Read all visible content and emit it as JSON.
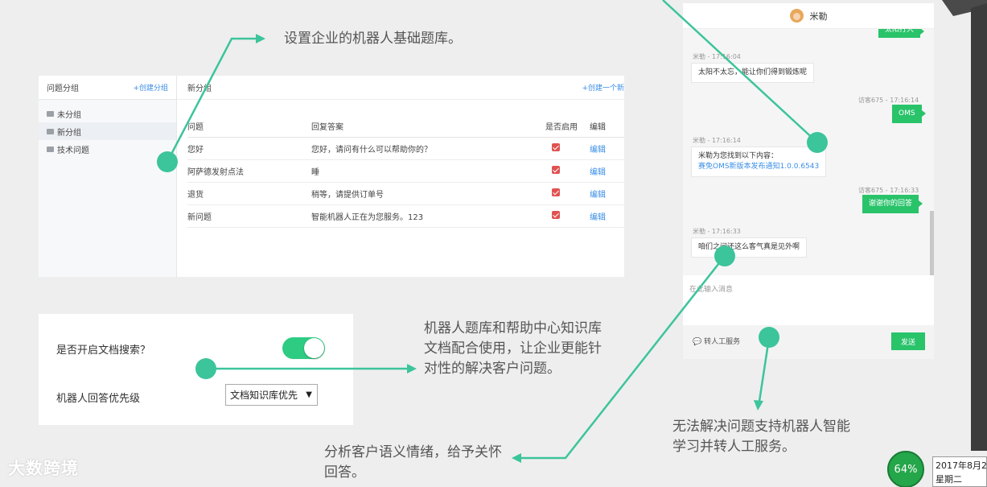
{
  "qlib": {
    "sidebar_title": "问题分组",
    "create_group": "+创建分组",
    "groups": [
      "未分组",
      "新分组",
      "技术问题"
    ],
    "main_title": "新分组",
    "create_question": "+创建一个新",
    "headers": [
      "问题",
      "回复答案",
      "是否启用",
      "编辑"
    ],
    "rows": [
      {
        "q": "您好",
        "a": "您好，请问有什么可以帮助你的？",
        "edit": "编辑"
      },
      {
        "q": "阿萨德发射点法",
        "a": "睡",
        "edit": "编辑"
      },
      {
        "q": "退货",
        "a": "稍等，请提供订单号",
        "edit": "编辑"
      },
      {
        "q": "新问题",
        "a": "智能机器人正在为您服务。123",
        "edit": "编辑"
      }
    ]
  },
  "settings": {
    "doc_search_label": "是否开启文档搜索？",
    "doc_search_enabled": true,
    "priority_label": "机器人回答优先级",
    "priority_value": "文档知识库优先"
  },
  "chat": {
    "agent_name": "米勒",
    "top_cut_bubble": "太阳打大",
    "msg1_meta": "米勒 - 17:16:04",
    "msg1_text": "太阳不太忘，能让你们得到锻炼呢",
    "msg2_meta": "访客675 - 17:16:14",
    "msg2_text": "OMS",
    "msg3_meta": "米勒 - 17:16:14",
    "msg3_line1": "米勒为您找到以下内容：",
    "msg3_link": "赛免OMS新版本发布通知1.0.0.6543",
    "msg4_meta": "访客675 - 17:16:33",
    "msg4_text": "谢谢你的回答",
    "msg5_meta": "米勒 - 17:16:33",
    "msg5_text": "咱们之间还这么客气真是见外啊",
    "input_placeholder": "在此输入消息",
    "transfer_label": "转人工服务",
    "send_label": "发送"
  },
  "notes": {
    "n1": "设置企业的机器人基础题库。",
    "n2": "机器人题库和帮助中心知识库文档配合使用，让企业更能针对性的解决客户问题。",
    "n3": "分析客户语义情绪，给予关怀回答。",
    "n4": "无法解决问题支持机器人智能学习并转人工服务。"
  },
  "desktop": {
    "watermark": "大数跨境",
    "percent": "64%",
    "date": "2017年8月2",
    "weekday": "星期二"
  },
  "colors": {
    "accent_green": "#3cc49b",
    "send_green": "#29c36a",
    "check_red": "#e05252",
    "link_blue": "#3a8ee6"
  }
}
